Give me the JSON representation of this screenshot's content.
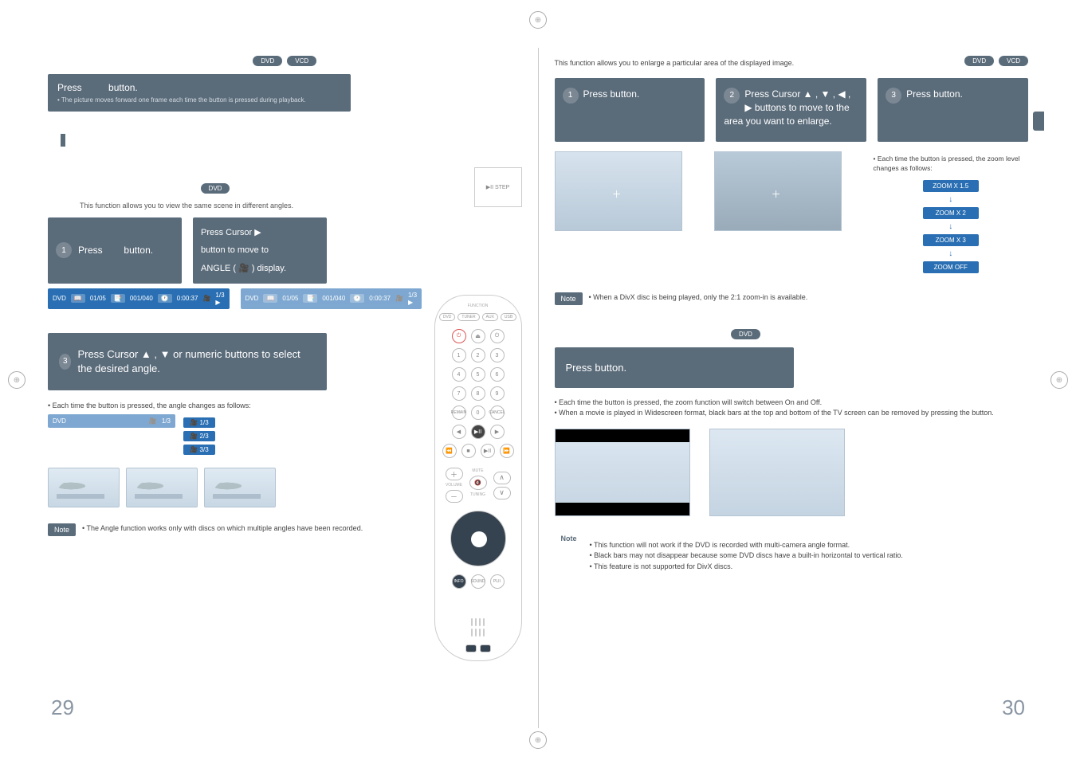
{
  "badges": {
    "dvd": "DVD",
    "vcd": "VCD"
  },
  "left_page": {
    "step_box": {
      "title_prefix": "Press",
      "title_suffix": "button.",
      "bullet": "• The picture moves forward one frame each time the button is pressed during playback."
    },
    "angle": {
      "intro": "This function allows you to view the same scene in different angles.",
      "step1_prefix": "Press",
      "step1_suffix": "button.",
      "step2_line1": "Press Cursor ▶",
      "step2_line2": "button to move to",
      "step2_line3": "ANGLE ( 🎥 ) display.",
      "osd": {
        "disc": "DVD",
        "title": "01/05",
        "chapter": "001/040",
        "time": "0:00:37",
        "angle": "1/3 ▶"
      },
      "wide_step": "Press Cursor ▲ , ▼ or numeric buttons to select the desired angle.",
      "note_line": "• Each time the button is pressed, the angle changes as follows:",
      "indicators": [
        "1/3",
        "2/3",
        "3/3"
      ],
      "note_tag": "Note",
      "note_text": "• The Angle function works only with discs on which multiple angles have been recorded."
    },
    "remote_mini": "▶II STEP",
    "pagenum": "29"
  },
  "right_page": {
    "zoom": {
      "intro": "This function allows you to enlarge a particular area of the displayed image.",
      "step1": "Press                 button.",
      "step2": "Press Cursor ▲ , ▼ , ◀ , ▶ buttons to move to the area you want to enlarge.",
      "step3": "Press          button.",
      "info_heading": "• Each time the button is pressed, the zoom level changes as follows:",
      "levels": [
        "ZOOM X 1.5",
        "ZOOM X 2",
        "ZOOM X 3",
        "ZOOM OFF"
      ],
      "note_tag": "Note",
      "note_text": "• When a DivX disc is being played, only the 2:1 zoom-in is available."
    },
    "ezview": {
      "step": "Press                 button.",
      "bullets": [
        "• Each time the button is pressed, the zoom function will switch between On and Off.",
        "• When a movie is played in Widescreen format, black bars at the top and bottom of the TV screen can be removed by pressing the                button."
      ],
      "note_tag": "Note",
      "notes": [
        "• This function will not work if the DVD is recorded with multi-camera angle format.",
        "• Black bars may not disappear because some DVD discs have a built-in horizontal to vertical ratio.",
        "• This feature is not supported for DivX discs."
      ]
    },
    "pagenum": "30"
  }
}
